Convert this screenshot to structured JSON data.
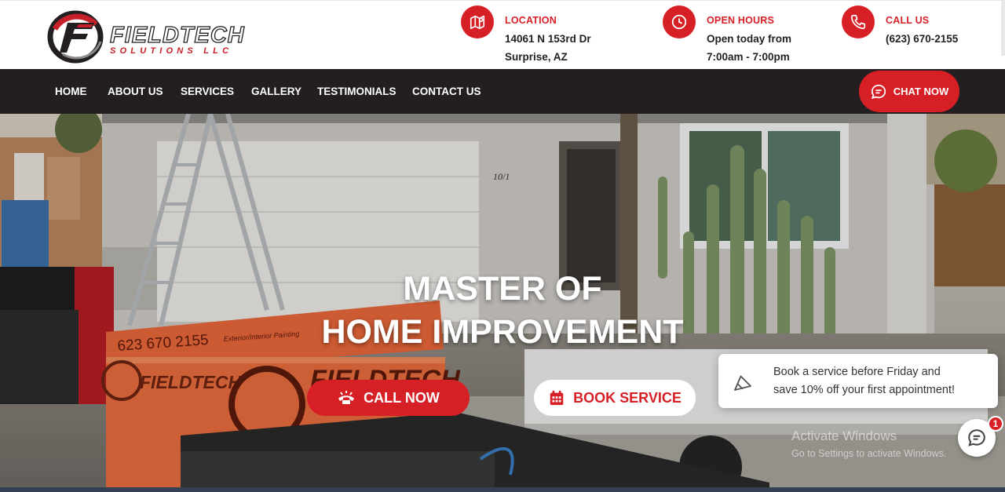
{
  "brand": {
    "name": "FIELDTECH",
    "sub": "SOLUTIONS LLC",
    "mark": "F"
  },
  "contact": {
    "location": {
      "label": "LOCATION",
      "line1": "14061 N 153rd Dr",
      "line2": "Surprise, AZ",
      "icon": "map-icon"
    },
    "hours": {
      "label": "OPEN HOURS",
      "line1": "Open today from",
      "line2": "7:00am - 7:00pm",
      "icon": "clock-icon"
    },
    "call": {
      "label": "CALL US",
      "line1": "(623) 670-2155",
      "icon": "phone-icon"
    }
  },
  "nav": {
    "items": [
      {
        "label": "HOME"
      },
      {
        "label": "ABOUT US"
      },
      {
        "label": "SERVICES"
      },
      {
        "label": "GALLERY"
      },
      {
        "label": "TESTIMONIALS"
      },
      {
        "label": "CONTACT US"
      }
    ],
    "chat_label": "CHAT NOW"
  },
  "hero": {
    "title_line1": "MASTER OF",
    "title_line2": "HOME IMPROVEMENT",
    "call_label": "CALL NOW",
    "book_label": "BOOK SERVICE",
    "truck_phone": "623 670 2155",
    "truck_brand": "FIELDTECH",
    "truck_sub": "Exterior/Interior Painting",
    "house_number": "10/1"
  },
  "promo": {
    "line1": "Book a service before Friday and",
    "line2": "save 10% off your first appointment!"
  },
  "watermark": {
    "line1": "Activate Windows",
    "line2": "Go to Settings to activate Windows."
  },
  "chat_widget": {
    "badge": "1"
  },
  "colors": {
    "brand_red": "#d71f26",
    "nav_dark": "#231f20"
  }
}
